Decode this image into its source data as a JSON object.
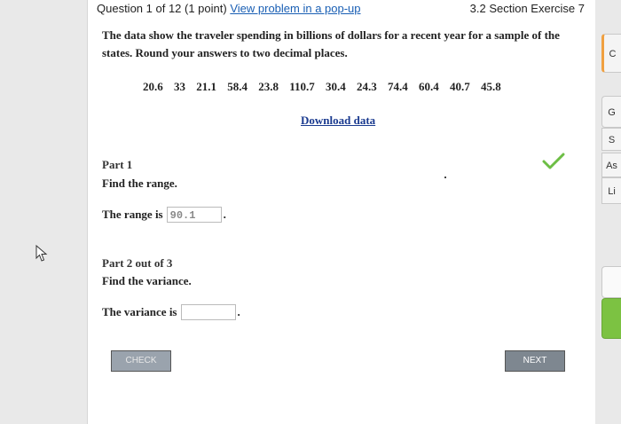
{
  "header": {
    "question_label": "Question 1 of 12 (1 point)",
    "popup_link": "View problem in a pop-up",
    "section": "3.2 Section Exercise 7"
  },
  "prompt": "The data show the traveler spending in billions of dollars for a recent year for a sample of the states. Round your answers to two decimal places.",
  "data_values": [
    "20.6",
    "33",
    "21.1",
    "58.4",
    "23.8",
    "110.7",
    "30.4",
    "24.3",
    "74.4",
    "60.4",
    "40.7",
    "45.8"
  ],
  "download_label": "Download data",
  "part1": {
    "heading": "Part 1",
    "task": "Find the range.",
    "answer_label": "The range is",
    "answer_value": "90.1",
    "answer_suffix": "."
  },
  "part2": {
    "heading": "Part 2 out of 3",
    "task": "Find the variance.",
    "answer_label": "The variance is",
    "answer_value": "",
    "answer_suffix": "."
  },
  "buttons": {
    "check": "CHECK",
    "next": "NEXT"
  },
  "side_tabs": [
    "C",
    "G",
    "S",
    "As",
    "Li"
  ],
  "colors": {
    "check_mark": "#6dbe45",
    "link": "#1a5fb4",
    "side_accent_orange": "#f0a040",
    "side_accent_green": "#7cc242"
  }
}
